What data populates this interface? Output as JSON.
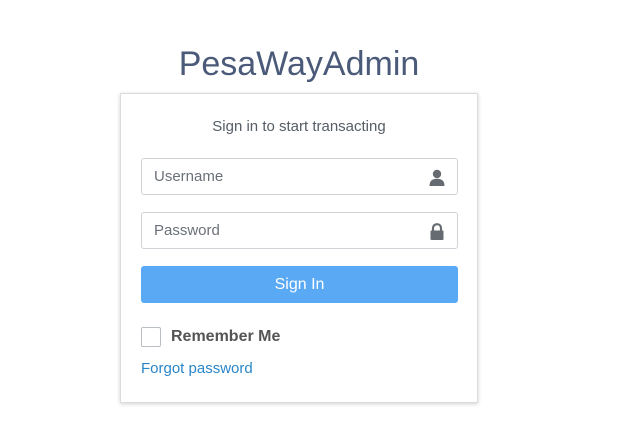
{
  "app": {
    "title": "PesaWayAdmin"
  },
  "login": {
    "subtitle": "Sign in to start transacting",
    "username_placeholder": "Username",
    "password_placeholder": "Password",
    "username_icon": "user-icon",
    "password_icon": "lock-icon",
    "signin_label": "Sign In",
    "remember_label": "Remember Me",
    "remember_checked": false,
    "forgot_label": "Forgot password"
  },
  "colors": {
    "title": "#4a5a78",
    "button": "#5aa9f5",
    "link": "#2a86c9"
  }
}
